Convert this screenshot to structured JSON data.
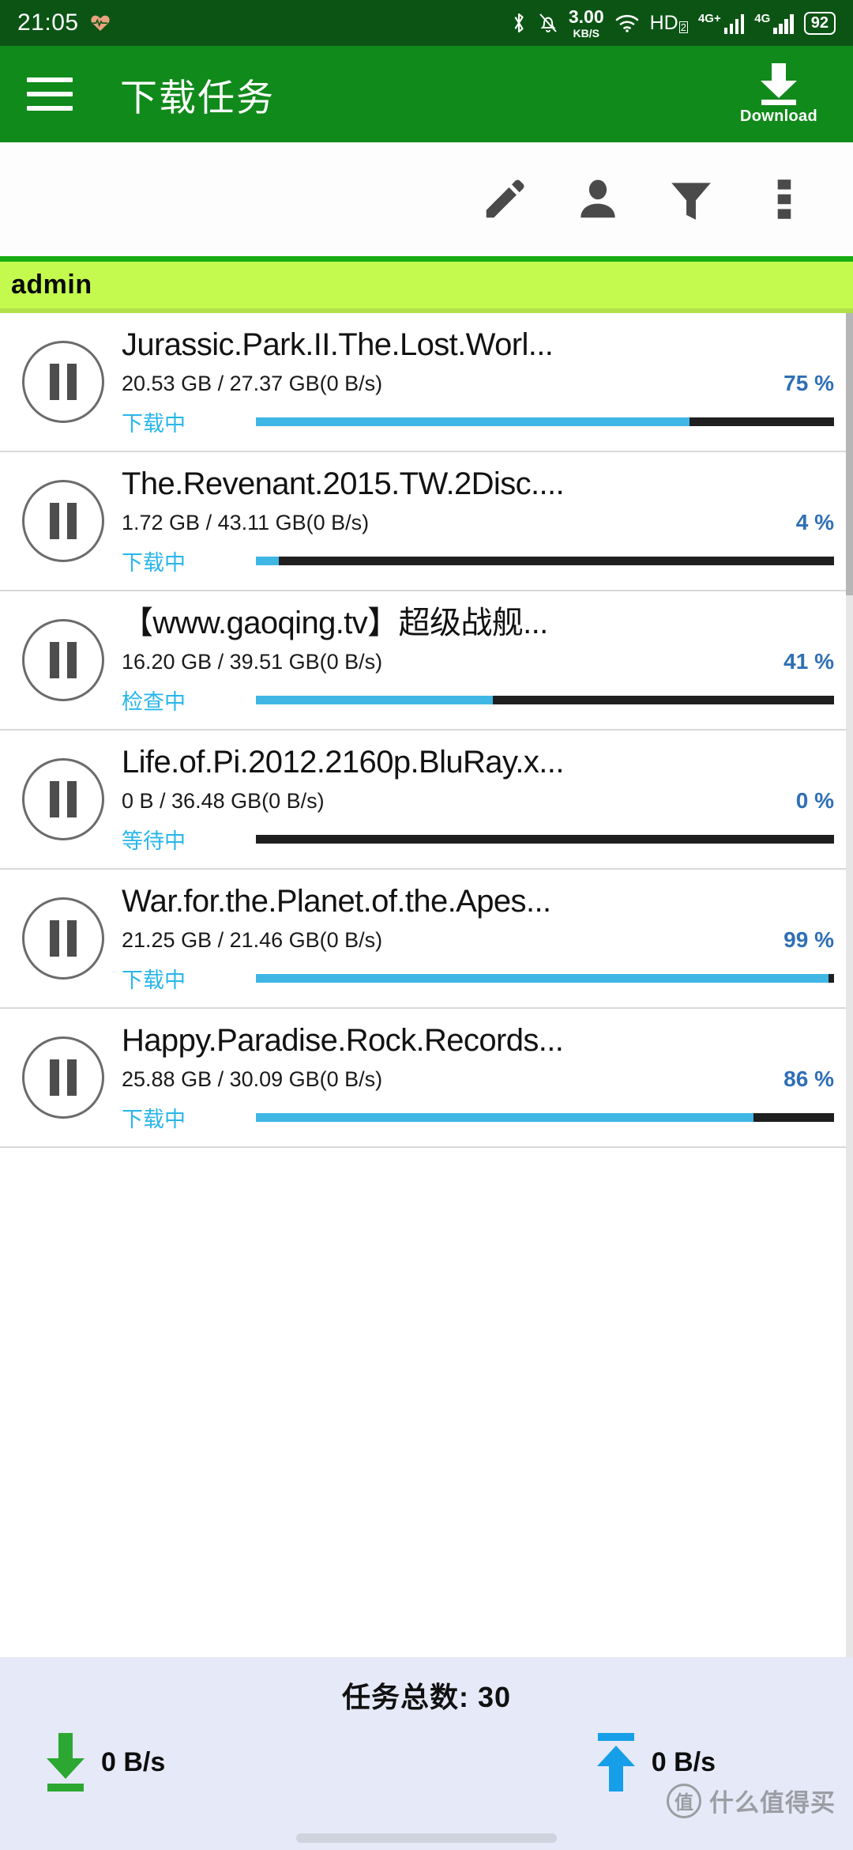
{
  "status_bar": {
    "time": "21:05",
    "icons": [
      "heart-rate-icon",
      "bluetooth-icon",
      "silent-bell-icon",
      "wifi-icon"
    ],
    "net_speed_value": "3.00",
    "net_speed_unit": "KB/S",
    "hd_label": "HD",
    "hd_sub": "2",
    "sim1_label": "4G+",
    "sim2_label": "4G",
    "battery": "92"
  },
  "app_bar": {
    "menu_icon": "hamburger-icon",
    "title": "下载任务",
    "download_icon": "download-arrow-icon",
    "download_label": "Download"
  },
  "toolbar": {
    "actions": [
      {
        "name": "edit-button",
        "icon": "pencil-icon"
      },
      {
        "name": "user-button",
        "icon": "person-icon"
      },
      {
        "name": "filter-button",
        "icon": "funnel-icon"
      },
      {
        "name": "overflow-button",
        "icon": "more-vertical-icon"
      }
    ]
  },
  "group": {
    "name": "admin"
  },
  "tasks": [
    {
      "title": "Jurassic.Park.II.The.Lost.Worl...",
      "size": "20.53 GB / 27.37 GB(0 B/s)",
      "percent_label": "75 %",
      "percent": 75,
      "state": "下载中",
      "control_icon": "pause-icon"
    },
    {
      "title": "The.Revenant.2015.TW.2Disc....",
      "size": "1.72 GB / 43.11 GB(0 B/s)",
      "percent_label": "4 %",
      "percent": 4,
      "state": "下载中",
      "control_icon": "pause-icon"
    },
    {
      "title": "【www.gaoqing.tv】超级战舰...",
      "size": "16.20 GB / 39.51 GB(0 B/s)",
      "percent_label": "41 %",
      "percent": 41,
      "state": "检查中",
      "control_icon": "pause-icon"
    },
    {
      "title": "Life.of.Pi.2012.2160p.BluRay.x...",
      "size": "0 B / 36.48 GB(0 B/s)",
      "percent_label": "0 %",
      "percent": 0,
      "state": "等待中",
      "control_icon": "pause-icon"
    },
    {
      "title": "War.for.the.Planet.of.the.Apes...",
      "size": "21.25 GB / 21.46 GB(0 B/s)",
      "percent_label": "99 %",
      "percent": 99,
      "state": "下载中",
      "control_icon": "pause-icon"
    },
    {
      "title": "Happy.Paradise.Rock.Records...",
      "size": "25.88 GB / 30.09 GB(0 B/s)",
      "percent_label": "86 %",
      "percent": 86,
      "state": "下载中",
      "control_icon": "pause-icon"
    }
  ],
  "bottom_bar": {
    "total_label": "任务总数: 30",
    "download_rate": "0 B/s",
    "upload_rate": "0 B/s",
    "download_icon": "arrow-down-icon",
    "upload_icon": "arrow-up-icon"
  },
  "watermark": {
    "logo": "值",
    "text": "什么值得买"
  },
  "colors": {
    "status_bar": "#0b5414",
    "app_bar": "#108a1a",
    "group_header": "#c4fa4e",
    "progress_fill": "#3fb6e4",
    "progress_track": "#1f1f1f",
    "percent_text": "#2f6fb5",
    "state_text": "#29b6ea",
    "bottom_bar": "#e5e9f8",
    "download_arrow": "#2ca832",
    "upload_arrow": "#169fe8"
  }
}
